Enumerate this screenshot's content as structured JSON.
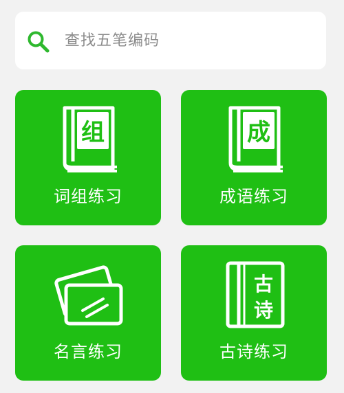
{
  "search": {
    "placeholder": "查找五笔编码",
    "icon": "search-icon"
  },
  "tiles": [
    {
      "label": "词组练习",
      "icon": "book-icon",
      "icon_text": "组"
    },
    {
      "label": "成语练习",
      "icon": "book-icon",
      "icon_text": "成"
    },
    {
      "label": "名言练习",
      "icon": "cards-icon"
    },
    {
      "label": "古诗练习",
      "icon": "scroll-book-icon",
      "icon_text_top": "古",
      "icon_text_bottom": "诗"
    }
  ],
  "colors": {
    "tile_green": "#1fbf14",
    "search_icon_green": "#2eb82e",
    "background": "#f2f2f2"
  }
}
